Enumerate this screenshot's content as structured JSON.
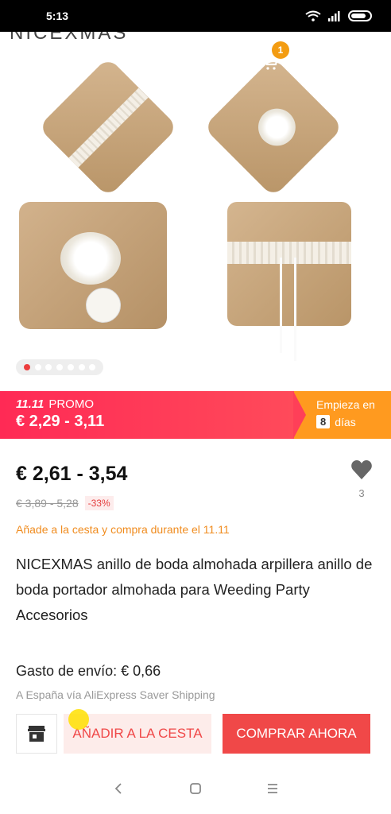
{
  "status_bar": {
    "time": "5:13"
  },
  "hero": {
    "brand_peek": "NICEXMAS",
    "cart_count": "1",
    "carousel": {
      "total": 7,
      "active": 1
    }
  },
  "promo": {
    "label_num": "11.11",
    "label_text": "PROMO",
    "price_range": "€ 2,29 - 3,11",
    "starts_in": "Empieza en",
    "days_value": "8",
    "days_unit": "días"
  },
  "product": {
    "price_range": "€ 2,61 - 3,54",
    "old_price_range": "€ 3,89 - 5,28",
    "discount": "-33%",
    "favorites_count": "3",
    "cart_promo_text": "Añade a la cesta y compra durante el 11.11",
    "title": "NICEXMAS anillo de boda almohada arpillera anillo de boda portador almohada para Weeding Party Accesorios",
    "shipping_cost": "Gasto de envío: € 0,66",
    "shipping_via": "A España vía AliExpress Saver Shipping"
  },
  "actions": {
    "add_to_cart": "AÑADIR A LA CESTA",
    "buy_now": "COMPRAR AHORA"
  },
  "colors": {
    "accent_red": "#f04848",
    "promo_orange": "#ff9a1f",
    "promo_pink": "#ff2a55",
    "badge_orange": "#f39c12"
  }
}
